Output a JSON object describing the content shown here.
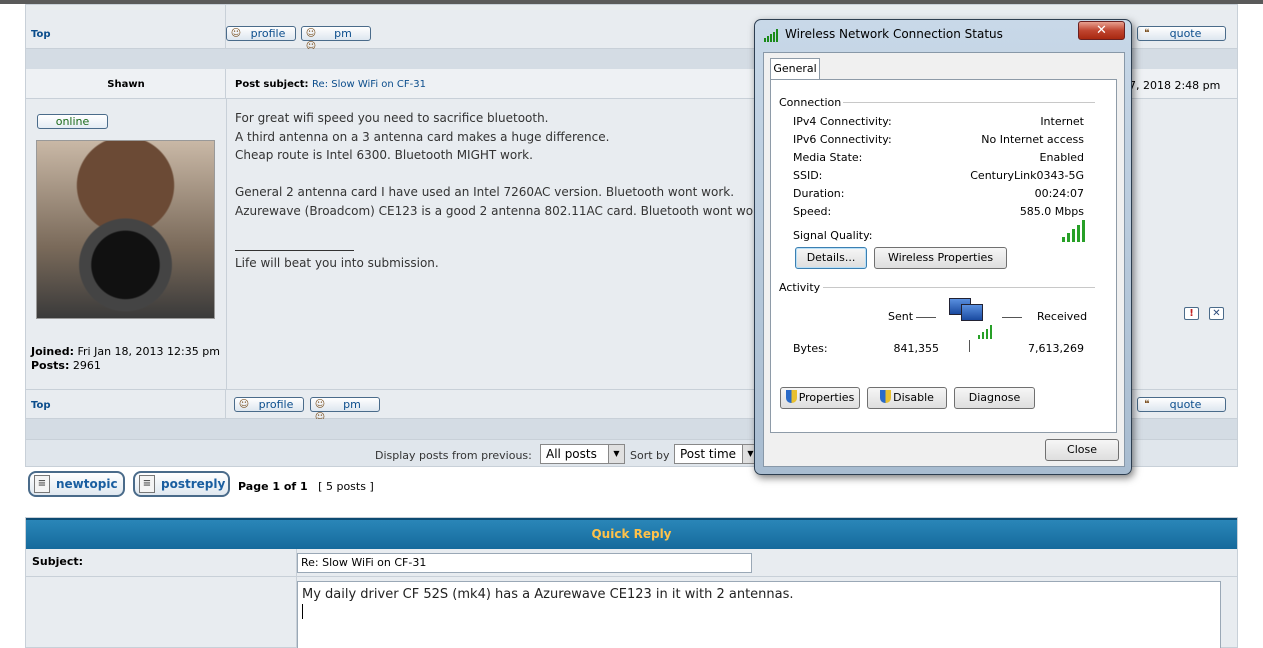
{
  "forum": {
    "top_link": "Top",
    "profile_label": "profile",
    "pm_label": "pm",
    "quote_label": "quote",
    "post": {
      "author": "Shawn",
      "subject_label": "Post subject:",
      "subject": "Re: Slow WiFi on CF-31",
      "date_partial": "7, 2018 2:48 pm",
      "online_label": "online",
      "lines": [
        "For great wifi speed you need to sacrifice bluetooth.",
        "A third antenna on a 3 antenna card makes a huge difference.",
        "Cheap route is Intel 6300. Bluetooth MIGHT work.",
        "",
        "General 2 antenna card I have used an Intel 7260AC version. Bluetooth wont work.",
        "Azurewave (Broadcom) CE123 is a good 2 antenna 802.11AC card. Bluetooth wont work."
      ],
      "signature": "Life will beat you into submission.",
      "joined_label": "Joined:",
      "joined_value": "Fri Jan 18, 2013 12:35 pm",
      "posts_label": "Posts:",
      "posts_value": "2961"
    },
    "display_label": "Display posts from previous:",
    "display_value": "All posts",
    "sort_label": "Sort by",
    "sort_value": "Post time",
    "newtopic_label": "newtopic",
    "postreply_label": "postreply",
    "page_info": "Page 1 of 1",
    "post_count": "[ 5 posts ]"
  },
  "quick_reply": {
    "title": "Quick Reply",
    "subject_label": "Subject:",
    "subject_value": "Re: Slow WiFi on CF-31",
    "message_value": "My daily driver CF 52S (mk4) has a Azurewave CE123 in it with 2 antennas."
  },
  "dialog": {
    "title": "Wireless Network Connection Status",
    "tab": "General",
    "connection_label": "Connection",
    "rows": [
      {
        "k": "IPv4 Connectivity:",
        "v": "Internet"
      },
      {
        "k": "IPv6 Connectivity:",
        "v": "No Internet access"
      },
      {
        "k": "Media State:",
        "v": "Enabled"
      },
      {
        "k": "SSID:",
        "v": "CenturyLink0343-5G"
      },
      {
        "k": "Duration:",
        "v": "00:24:07"
      },
      {
        "k": "Speed:",
        "v": "585.0 Mbps"
      }
    ],
    "signal_label": "Signal Quality:",
    "details_button": "Details...",
    "wireless_props_button": "Wireless Properties",
    "activity_label": "Activity",
    "sent_label": "Sent",
    "received_label": "Received",
    "bytes_label": "Bytes:",
    "bytes_sent": "841,355",
    "bytes_received": "7,613,269",
    "properties_button": "Properties",
    "disable_button": "Disable",
    "diagnose_button": "Diagnose",
    "close_button": "Close"
  }
}
